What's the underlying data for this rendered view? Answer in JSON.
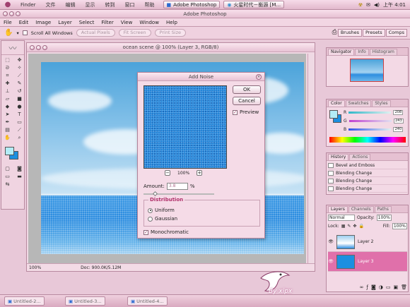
{
  "macbar": {
    "menus": [
      "Finder",
      "文件",
      "编辑",
      "显示",
      "转到",
      "窗口",
      "帮助"
    ],
    "task_ps": "Adobe Photoshop",
    "task_browser": "火星时代－衡源 [M...",
    "clock": "上午 4:01"
  },
  "ps": {
    "title": "Adobe Photoshop",
    "menus": [
      "File",
      "Edit",
      "Image",
      "Layer",
      "Select",
      "Filter",
      "View",
      "Window",
      "Help"
    ],
    "options": {
      "scroll_all": "Scroll All Windows",
      "actual_pixels": "Actual Pixels",
      "fit_screen": "Fit Screen",
      "print_size": "Print Size"
    },
    "well_tabs": [
      "Brushes",
      "Presets",
      "Comps"
    ]
  },
  "document": {
    "title": "ocean scene @ 100% (Layer 3, RGB/8)",
    "zoom": "100%",
    "doc_size": "Doc: 900.0K/5.12M"
  },
  "dialog": {
    "title": "Add Noise",
    "ok": "OK",
    "cancel": "Cancel",
    "preview_label": "Preview",
    "zoom": "100%",
    "zoom_out": "−",
    "zoom_in": "+",
    "amount_label": "Amount:",
    "amount_value": "3.8",
    "amount_unit": "%",
    "amount_fraction": 0.038,
    "distribution_title": "Distribution",
    "uniform": "Uniform",
    "gaussian": "Gaussian",
    "distribution_selected": "Uniform",
    "monochromatic": "Monochromatic"
  },
  "navigator": {
    "tabs": [
      "Navigator",
      "Info",
      "Histogram"
    ]
  },
  "color": {
    "tabs": [
      "Color",
      "Swatches",
      "Styles"
    ],
    "channels": [
      {
        "label": "R",
        "value": "208",
        "color": "#4fd6e6"
      },
      {
        "label": "G",
        "value": "243",
        "color": "#c04ad0"
      },
      {
        "label": "B",
        "value": "240",
        "color": "#4a60e8"
      }
    ]
  },
  "history": {
    "tabs": [
      "History",
      "Actions"
    ],
    "items": [
      "Bevel and Emboss",
      "Blending Change",
      "Blending Change",
      "Blending Change"
    ]
  },
  "layers": {
    "tabs": [
      "Layers",
      "Channels",
      "Paths"
    ],
    "blend_mode": "Normal",
    "opacity_label": "Opacity:",
    "opacity": "100%",
    "lock_label": "Lock:",
    "fill_label": "Fill:",
    "fill": "100%",
    "items": [
      {
        "name": "Layer 2",
        "selected": false
      },
      {
        "name": "Layer 3",
        "selected": true
      }
    ]
  },
  "dock": {
    "items": [
      "Untitled-2...",
      "Untitled-3...",
      "Untitled-4..."
    ]
  },
  "watermark": "By xipx",
  "colors": {
    "foreground": "#b3ecf6",
    "background": "#1c8fe0",
    "accent": "#e070aa"
  }
}
